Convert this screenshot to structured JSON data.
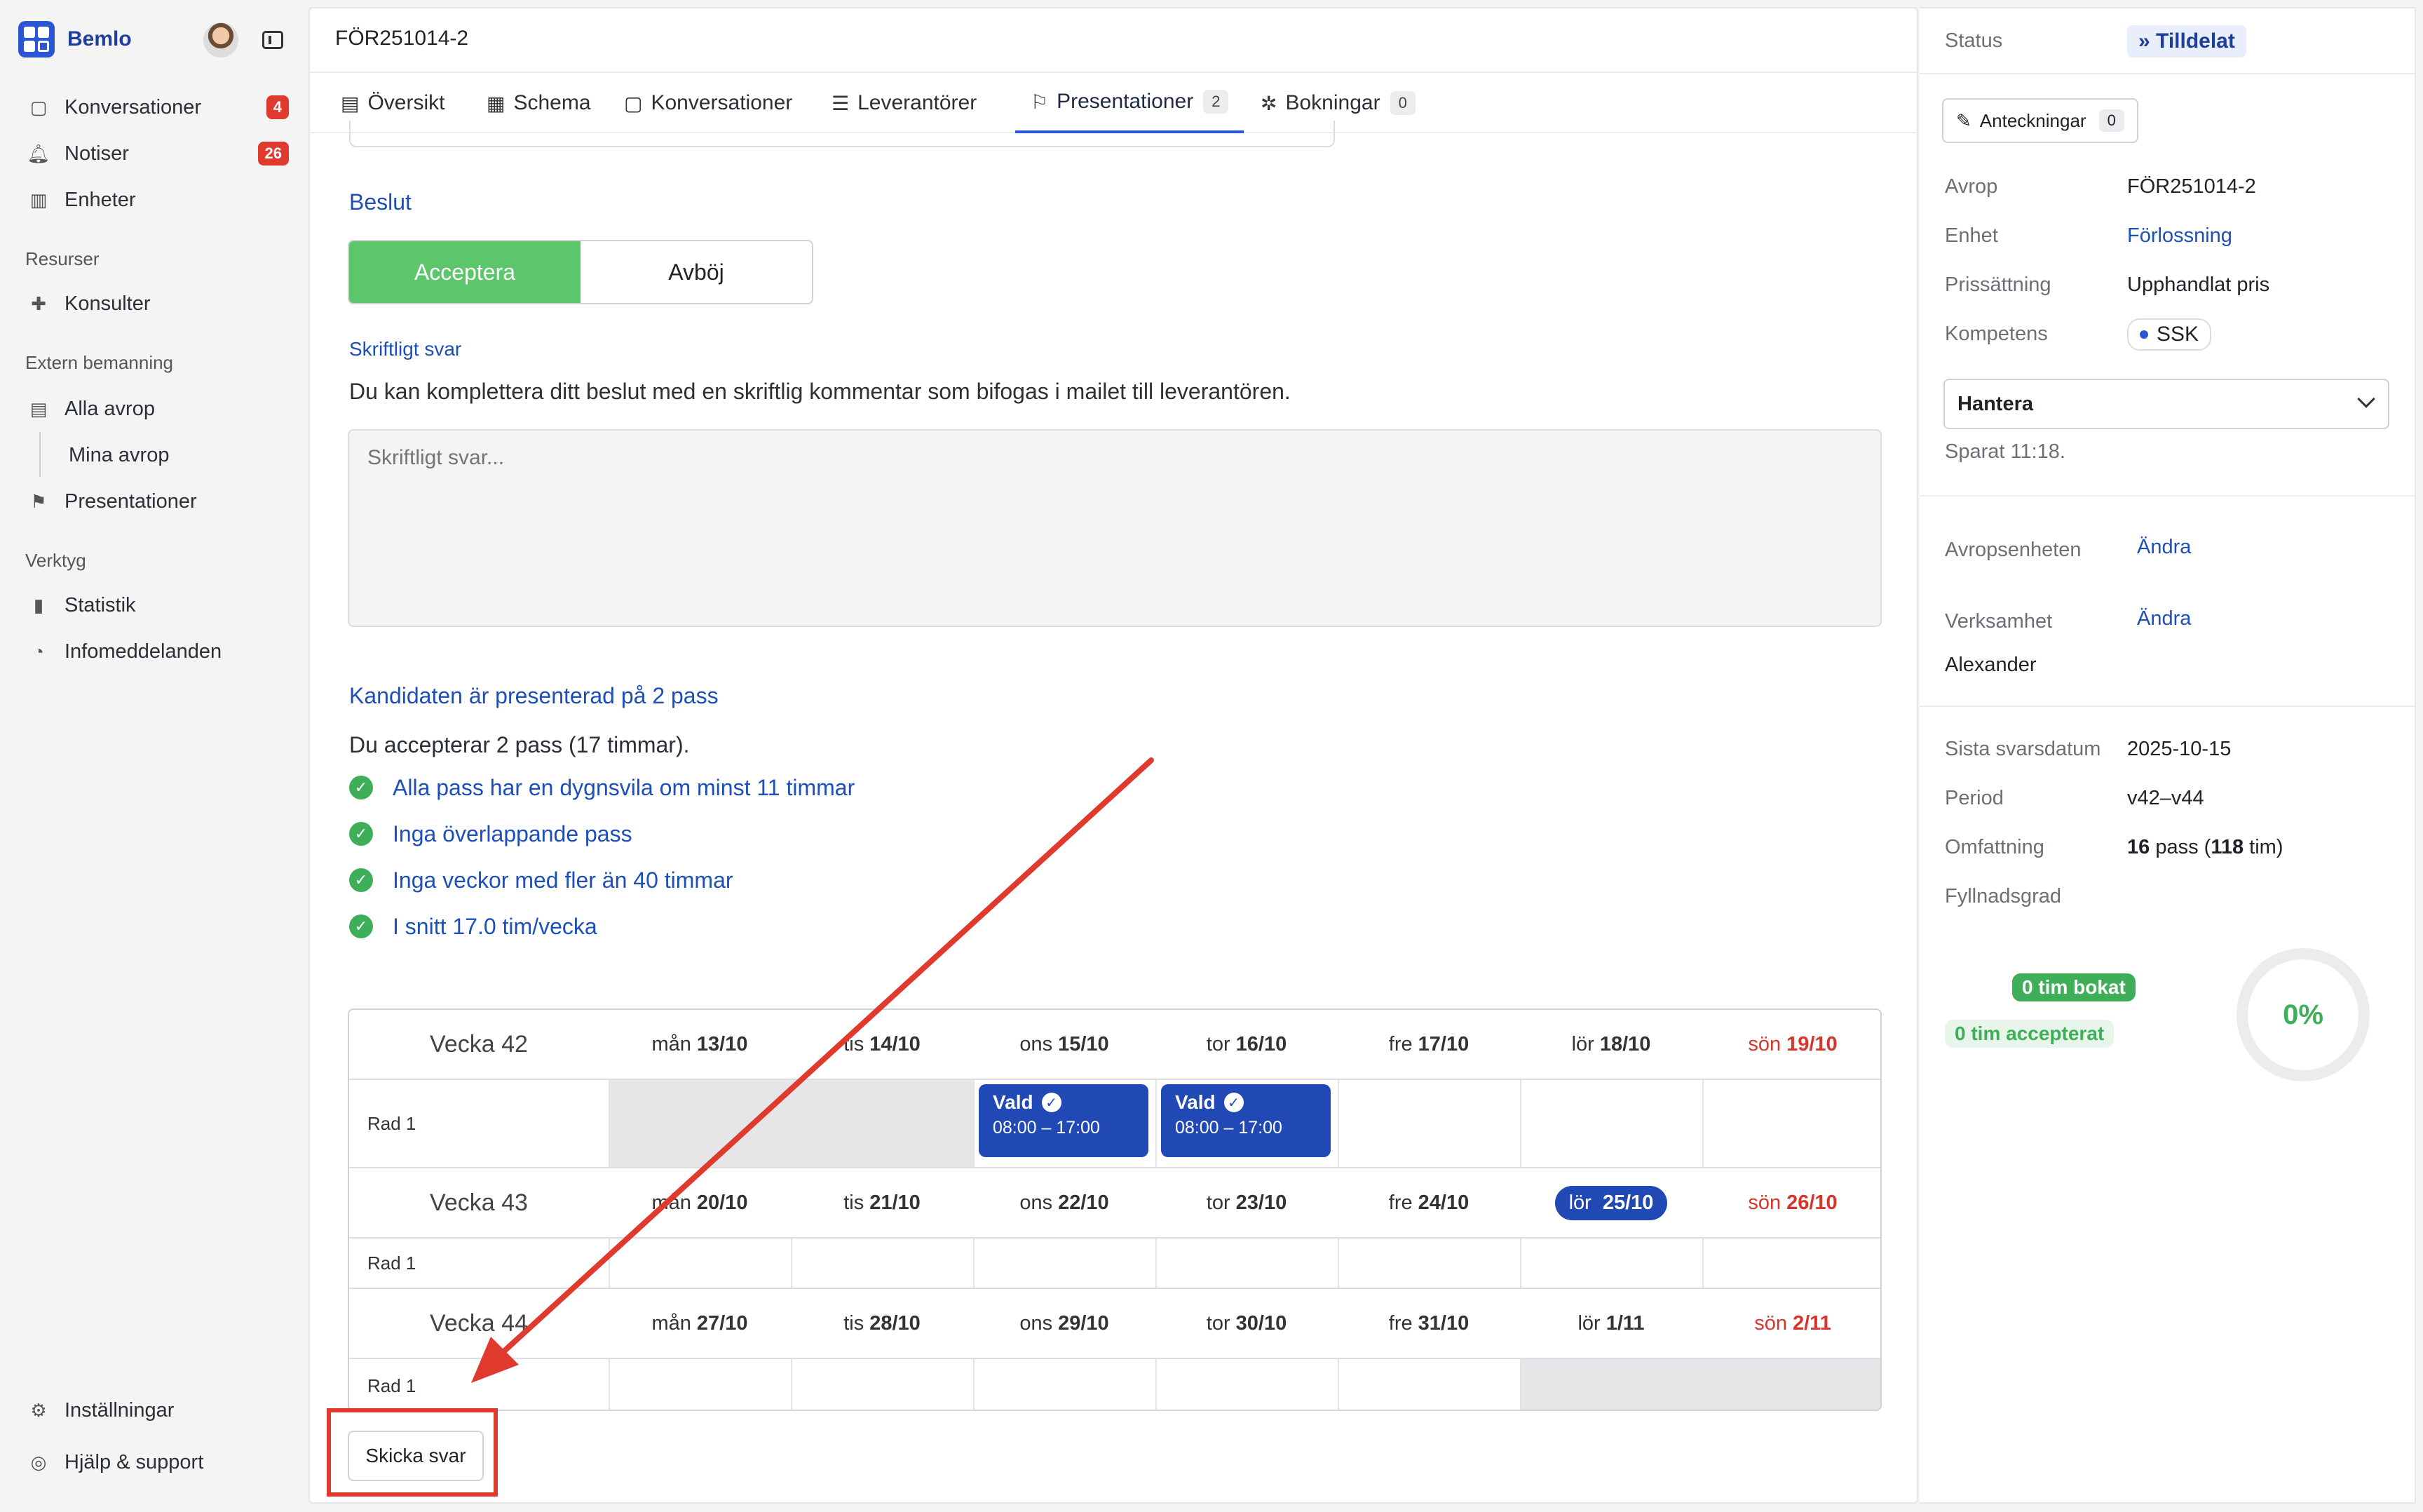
{
  "sidebar": {
    "brand": "Bemlo",
    "items": [
      {
        "label": "Konversationer",
        "badge": "4"
      },
      {
        "label": "Notiser",
        "badge": "26"
      },
      {
        "label": "Enheter"
      }
    ],
    "section_resources": "Resurser",
    "resources": [
      {
        "label": "Konsulter"
      }
    ],
    "section_external": "Extern bemanning",
    "external": [
      {
        "label": "Alla avrop"
      },
      {
        "label": "Mina avrop"
      },
      {
        "label": "Presentationer"
      }
    ],
    "section_tools": "Verktyg",
    "tools": [
      {
        "label": "Statistik"
      },
      {
        "label": "Infomeddelanden"
      }
    ],
    "settings": "Inställningar",
    "help": "Hjälp & support"
  },
  "header": {
    "title": "FÖR251014-2"
  },
  "tabs": [
    {
      "label": "Översikt"
    },
    {
      "label": "Schema"
    },
    {
      "label": "Konversationer"
    },
    {
      "label": "Leverantörer"
    },
    {
      "label": "Presentationer",
      "count": "2"
    },
    {
      "label": "Bokningar",
      "count": "0"
    }
  ],
  "decision": {
    "title": "Beslut",
    "accept": "Acceptera",
    "decline": "Avböj",
    "written_label": "Skriftligt svar",
    "written_help": "Du kan komplettera ditt beslut med en skriftlig kommentar som bifogas i mailet till leverantören.",
    "written_placeholder": "Skriftligt svar..."
  },
  "candidate": {
    "title": "Kandidaten är presenterad på 2 pass",
    "summary": "Du accepterar 2 pass (17 timmar).",
    "checks": [
      "Alla pass har en dygnsvila om minst 11 timmar",
      "Inga överlappande pass",
      "Inga veckor med fler än 40 timmar",
      "I snitt 17.0 tim/vecka"
    ]
  },
  "schedule": {
    "row_label": "Rad 1",
    "weeks": [
      {
        "name": "Vecka 42",
        "days": [
          [
            "mån",
            "13/10"
          ],
          [
            "tis",
            "14/10"
          ],
          [
            "ons",
            "15/10"
          ],
          [
            "tor",
            "16/10"
          ],
          [
            "fre",
            "17/10"
          ],
          [
            "lör",
            "18/10"
          ],
          [
            "sön",
            "19/10"
          ]
        ]
      },
      {
        "name": "Vecka 43",
        "days": [
          [
            "mån",
            "20/10"
          ],
          [
            "tis",
            "21/10"
          ],
          [
            "ons",
            "22/10"
          ],
          [
            "tor",
            "23/10"
          ],
          [
            "fre",
            "24/10"
          ],
          [
            "lör",
            "25/10"
          ],
          [
            "sön",
            "26/10"
          ]
        ]
      },
      {
        "name": "Vecka 44",
        "days": [
          [
            "mån",
            "27/10"
          ],
          [
            "tis",
            "28/10"
          ],
          [
            "ons",
            "29/10"
          ],
          [
            "tor",
            "30/10"
          ],
          [
            "fre",
            "31/10"
          ],
          [
            "lör",
            "1/11"
          ],
          [
            "sön",
            "2/11"
          ]
        ]
      }
    ],
    "shift_status": "Vald",
    "shift_time": "08:00 – 17:00"
  },
  "send_button": "Skicka svar",
  "right": {
    "status_label": "Status",
    "status_value": "Tilldelat",
    "notes_label": "Anteckningar",
    "notes_count": "0",
    "fields": [
      {
        "label": "Avrop",
        "value": "FÖR251014-2"
      },
      {
        "label": "Enhet",
        "value": "Förlossning"
      },
      {
        "label": "Prissättning",
        "value": "Upphandlat pris"
      },
      {
        "label": "Kompetens",
        "value": "SSK"
      }
    ],
    "select_value": "Hantera",
    "saved": "Sparat 11:18.",
    "unit_label": "Avropsenheten",
    "unit_action": "Ändra",
    "org_label": "Verksamhet",
    "org_action": "Ändra",
    "org_value": "Alexander",
    "deadline_label": "Sista svarsdatum",
    "deadline_value": "2025-10-15",
    "period_label": "Period",
    "period_value": "v42–v44",
    "scope_label": "Omfattning",
    "scope_pass": "16",
    "scope_pass_unit": "pass (",
    "scope_hours": "118",
    "scope_hours_unit": "tim)",
    "fill_label": "Fyllnadsgrad",
    "booked": "0 tim bokat",
    "accepted": "0 tim accepterat",
    "fill_percent": "0%"
  },
  "colors": {
    "accent": "#2b56d4",
    "accept_green": "#5cc66a",
    "sunday_red": "#d9342b",
    "annotation_red": "#e0392d"
  }
}
